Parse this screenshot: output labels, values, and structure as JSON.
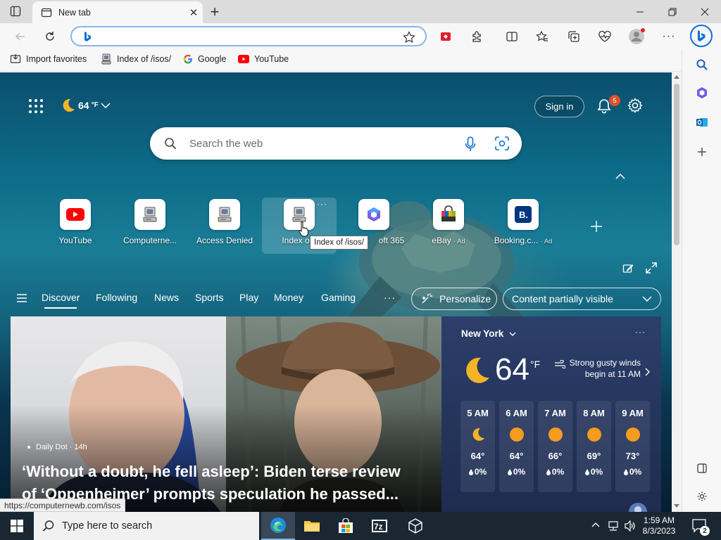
{
  "browser": {
    "tab_title": "New tab",
    "close_tab_symbol": "✕",
    "new_tab_symbol": "+",
    "address_value": ""
  },
  "favorites": [
    {
      "label": "Import favorites",
      "icon": "import-icon"
    },
    {
      "label": "Index of /isos/",
      "icon": "computer-icon"
    },
    {
      "label": "Google",
      "icon": "google-icon"
    },
    {
      "label": "YouTube",
      "icon": "youtube-icon"
    }
  ],
  "top": {
    "temperature": "64",
    "temp_unit": "°F",
    "sign_in": "Sign in",
    "notification_count": "5"
  },
  "search": {
    "placeholder": "Search the web"
  },
  "tiles": [
    {
      "label": "YouTube",
      "icon": "youtube-icon",
      "ad": ""
    },
    {
      "label": "Computerne...",
      "icon": "computer-icon",
      "ad": ""
    },
    {
      "label": "Access Denied",
      "icon": "computer-icon",
      "ad": ""
    },
    {
      "label": "Index of /",
      "icon": "computer-icon",
      "ad": ""
    },
    {
      "label": "oft 365",
      "icon": "microsoft365-icon",
      "ad": ""
    },
    {
      "label": "eBay",
      "icon": "ebay-icon",
      "ad": "· Ad"
    },
    {
      "label": "Booking.c...",
      "icon": "booking-icon",
      "ad": "· Ad"
    }
  ],
  "tile_more_symbol": "···",
  "tooltip": "Index of /isos/",
  "feed_nav": {
    "items": [
      "Discover",
      "Following",
      "News",
      "Sports",
      "Play",
      "Money",
      "Gaming"
    ],
    "more": "···",
    "personalize": "Personalize",
    "content_visibility": "Content partially visible"
  },
  "story": {
    "source": "Daily Dot · 14h",
    "headline_line1": "‘Without a doubt, he fell asleep’: Biden terse review",
    "headline_line2": "of ‘Oppenheimer’ prompts speculation he passed..."
  },
  "weather": {
    "location": "New York",
    "more": "···",
    "temperature": "64",
    "unit": "°F",
    "alert_line1": "Strong gusty winds",
    "alert_line2": "begin at 11 AM",
    "hours": [
      {
        "time": "5 AM",
        "icon": "moon-icon",
        "temp": "64°",
        "precip": "0%"
      },
      {
        "time": "6 AM",
        "icon": "sun-icon",
        "temp": "64°",
        "precip": "0%"
      },
      {
        "time": "7 AM",
        "icon": "sun-icon",
        "temp": "66°",
        "precip": "0%"
      },
      {
        "time": "8 AM",
        "icon": "sun-icon",
        "temp": "69°",
        "precip": "0%"
      },
      {
        "time": "9 AM",
        "icon": "sun-icon",
        "temp": "73°",
        "precip": "0%"
      }
    ]
  },
  "status_url": "https://computernewb.com/isos",
  "taskbar": {
    "search_placeholder": "Type here to search",
    "time": "1:59 AM",
    "date": "8/3/2023",
    "notification_count": "2"
  },
  "colors": {
    "accent": "#0b6fd8",
    "youtube_red": "#ff0000",
    "notification_badge": "#d9512c",
    "sun": "#f59b1d"
  }
}
